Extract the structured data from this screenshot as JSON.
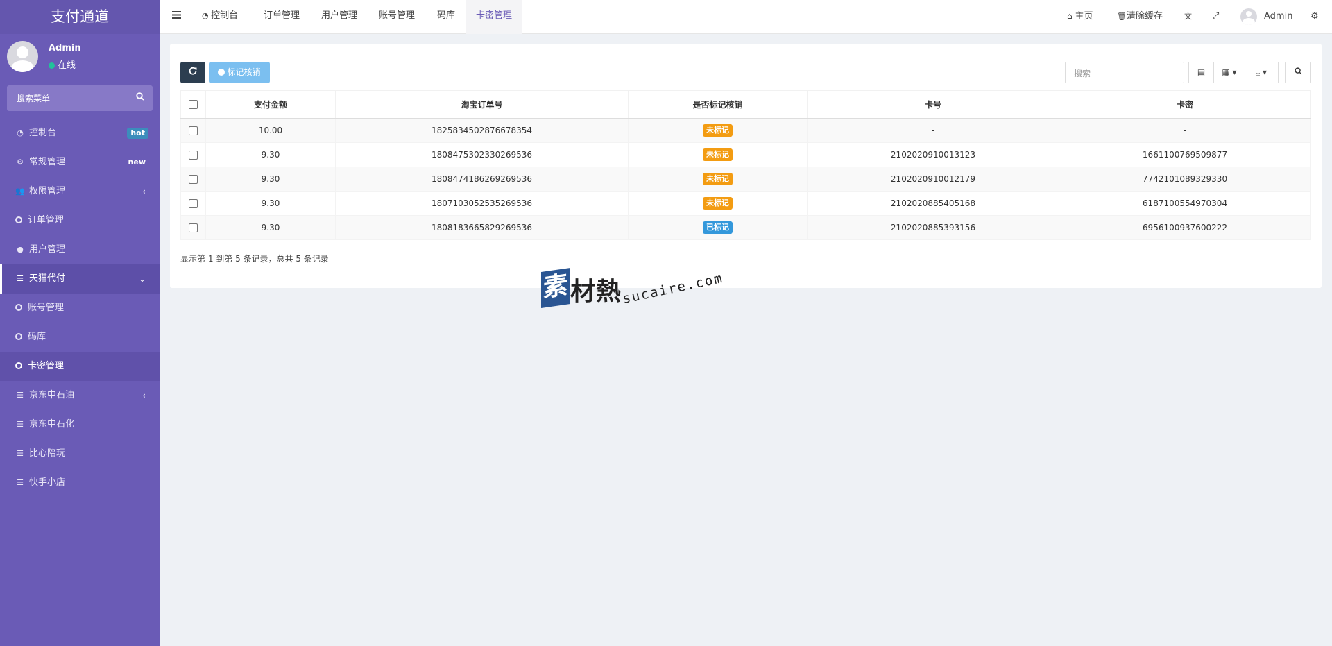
{
  "sidebar": {
    "brand": "支付通道",
    "user": {
      "name": "Admin",
      "status": "在线"
    },
    "search_placeholder": "搜索菜单",
    "items": [
      {
        "label": "控制台",
        "badge": "hot"
      },
      {
        "label": "常规管理",
        "badge": "new"
      },
      {
        "label": "权限管理"
      },
      {
        "label": "订单管理"
      },
      {
        "label": "用户管理"
      },
      {
        "label": "天猫代付"
      },
      {
        "label": "账号管理"
      },
      {
        "label": "码库"
      },
      {
        "label": "卡密管理"
      },
      {
        "label": "京东中石油"
      },
      {
        "label": "京东中石化"
      },
      {
        "label": "比心陪玩"
      },
      {
        "label": "快手小店"
      }
    ]
  },
  "topnav": {
    "tabs": [
      "控制台",
      "订单管理",
      "用户管理",
      "账号管理",
      "码库",
      "卡密管理"
    ],
    "right": {
      "home": "主页",
      "clear_cache": "清除缓存",
      "user": "Admin"
    }
  },
  "toolbar": {
    "mark_button": "标记核销",
    "search_placeholder": "搜索"
  },
  "table": {
    "headers": [
      "支付金额",
      "淘宝订单号",
      "是否标记核销",
      "卡号",
      "卡密"
    ],
    "rows": [
      {
        "amount": "10.00",
        "order": "1825834502876678354",
        "mark": "未标记",
        "card_no": "-",
        "card_pwd": "-"
      },
      {
        "amount": "9.30",
        "order": "1808475302330269536",
        "mark": "未标记",
        "card_no": "2102020910013123",
        "card_pwd": "1661100769509877"
      },
      {
        "amount": "9.30",
        "order": "1808474186269269536",
        "mark": "未标记",
        "card_no": "2102020910012179",
        "card_pwd": "7742101089329330"
      },
      {
        "amount": "9.30",
        "order": "1807103052535269536",
        "mark": "未标记",
        "card_no": "2102020885405168",
        "card_pwd": "6187100554970304"
      },
      {
        "amount": "9.30",
        "order": "1808183665829269536",
        "mark": "已标记",
        "card_no": "2102020885393156",
        "card_pwd": "6956100937600222"
      }
    ]
  },
  "pagination_info": "显示第 1 到第 5 条记录，总共 5 条记录",
  "watermark": {
    "mark": "素",
    "text": "材熱",
    "url": "sucaire.com"
  },
  "colors": {
    "sidebar": "#6a5bb6",
    "accent": "#6a5bb6",
    "warning": "#f39c12",
    "info": "#3498db",
    "dark_button": "#2c3e50"
  }
}
